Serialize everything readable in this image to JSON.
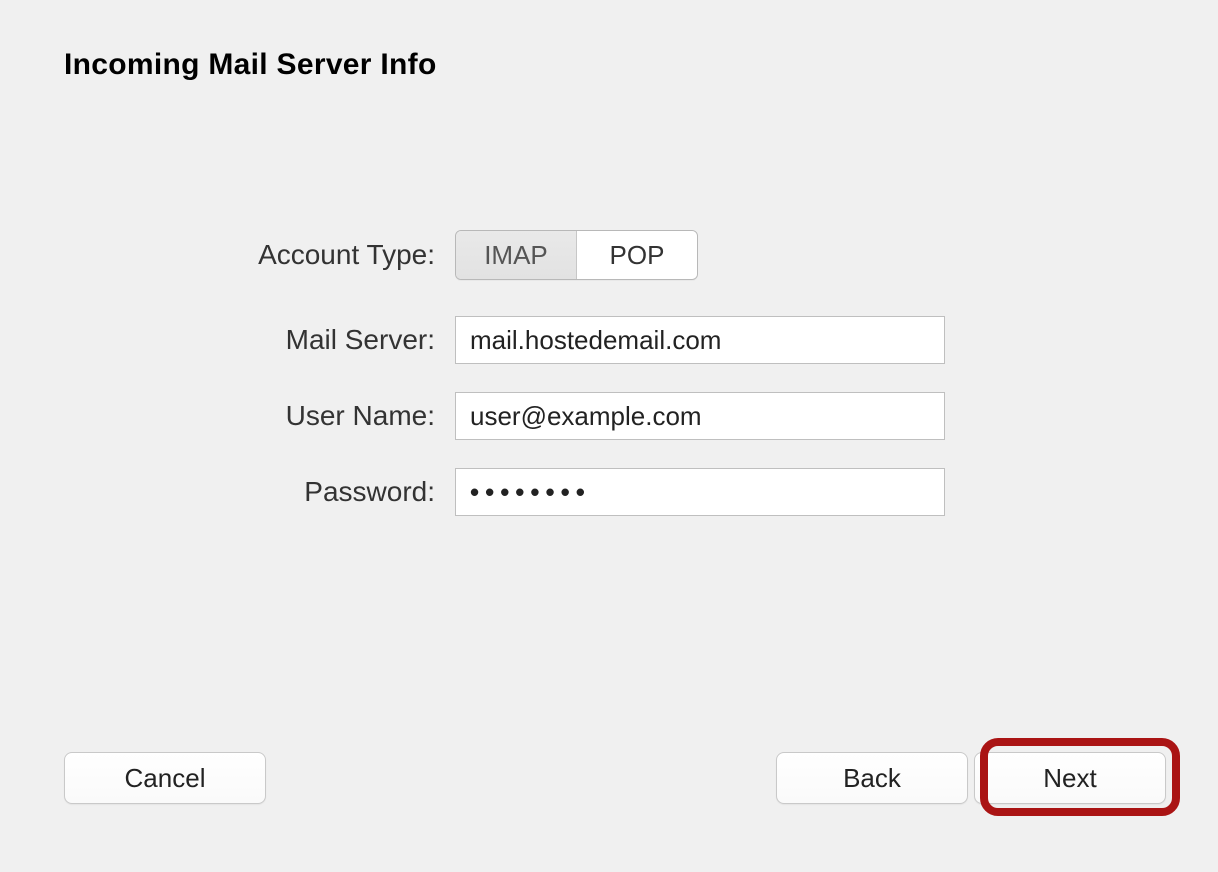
{
  "title": "Incoming Mail Server Info",
  "form": {
    "account_type": {
      "label": "Account Type:",
      "options": [
        "IMAP",
        "POP"
      ],
      "selected": "IMAP"
    },
    "mail_server": {
      "label": "Mail Server:",
      "value": "mail.hostedemail.com"
    },
    "user_name": {
      "label": "User Name:",
      "value": "user@example.com"
    },
    "password": {
      "label": "Password:",
      "mask": "••••••••"
    }
  },
  "buttons": {
    "cancel": "Cancel",
    "back": "Back",
    "next": "Next"
  }
}
